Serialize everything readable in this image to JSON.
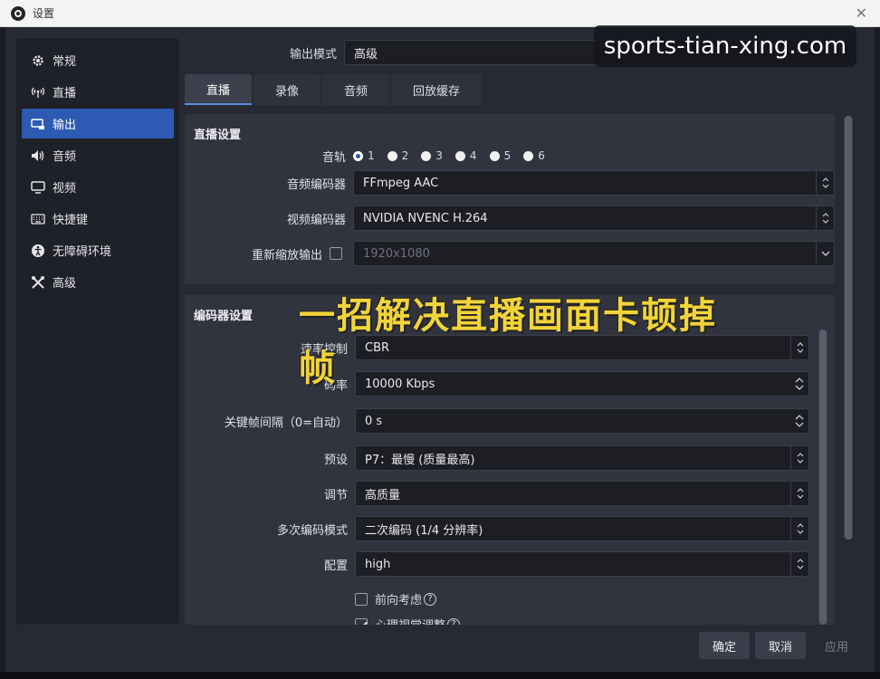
{
  "window": {
    "title": "设置",
    "close_icon": "close-icon"
  },
  "sidebar": {
    "items": [
      {
        "label": "常规",
        "icon": "gear-icon",
        "active": false
      },
      {
        "label": "直播",
        "icon": "antenna-icon",
        "active": false
      },
      {
        "label": "输出",
        "icon": "output-icon",
        "active": true
      },
      {
        "label": "音频",
        "icon": "speaker-icon",
        "active": false
      },
      {
        "label": "视频",
        "icon": "monitor-icon",
        "active": false
      },
      {
        "label": "快捷键",
        "icon": "keyboard-icon",
        "active": false
      },
      {
        "label": "无障碍环境",
        "icon": "accessibility-icon",
        "active": false
      },
      {
        "label": "高级",
        "icon": "tools-icon",
        "active": false
      }
    ]
  },
  "output_mode": {
    "label": "输出模式",
    "value": "高级"
  },
  "tabs": [
    {
      "label": "直播",
      "active": true
    },
    {
      "label": "录像",
      "active": false
    },
    {
      "label": "音频",
      "active": false
    },
    {
      "label": "回放缓存",
      "active": false
    }
  ],
  "stream_settings": {
    "title": "直播设置",
    "audio_track": {
      "label": "音轨",
      "options": [
        "1",
        "2",
        "3",
        "4",
        "5",
        "6"
      ],
      "selected": "1"
    },
    "audio_encoder": {
      "label": "音频编码器",
      "value": "FFmpeg AAC"
    },
    "video_encoder": {
      "label": "视频编码器",
      "value": "NVIDIA NVENC H.264"
    },
    "rescale": {
      "label": "重新缩放输出",
      "checked": false,
      "value": "1920x1080"
    }
  },
  "encoder_settings": {
    "title": "编码器设置",
    "rate_control": {
      "label": "速率控制",
      "value": "CBR"
    },
    "bitrate": {
      "label": "码率",
      "value": "10000 Kbps"
    },
    "keyframe": {
      "label": "关键帧间隔（0=自动）",
      "value": "0 s"
    },
    "preset": {
      "label": "预设",
      "value": "P7：最慢 (质量最高)"
    },
    "tuning": {
      "label": "调节",
      "value": "高质量"
    },
    "multipass": {
      "label": "多次编码模式",
      "value": "二次编码 (1/4 分辨率)"
    },
    "profile": {
      "label": "配置",
      "value": "high"
    },
    "lookahead": {
      "label": "前向考虑",
      "checked": false
    },
    "psycho": {
      "label": "心理视觉调整",
      "checked": true
    }
  },
  "buttons": {
    "ok": "确定",
    "cancel": "取消",
    "apply": "应用"
  },
  "watermark": "sports-tian-xing.com",
  "caption": "一招解决直播画面卡顿掉帧",
  "colors": {
    "accent": "#2d5ab3",
    "caption": "#f2d43a"
  }
}
